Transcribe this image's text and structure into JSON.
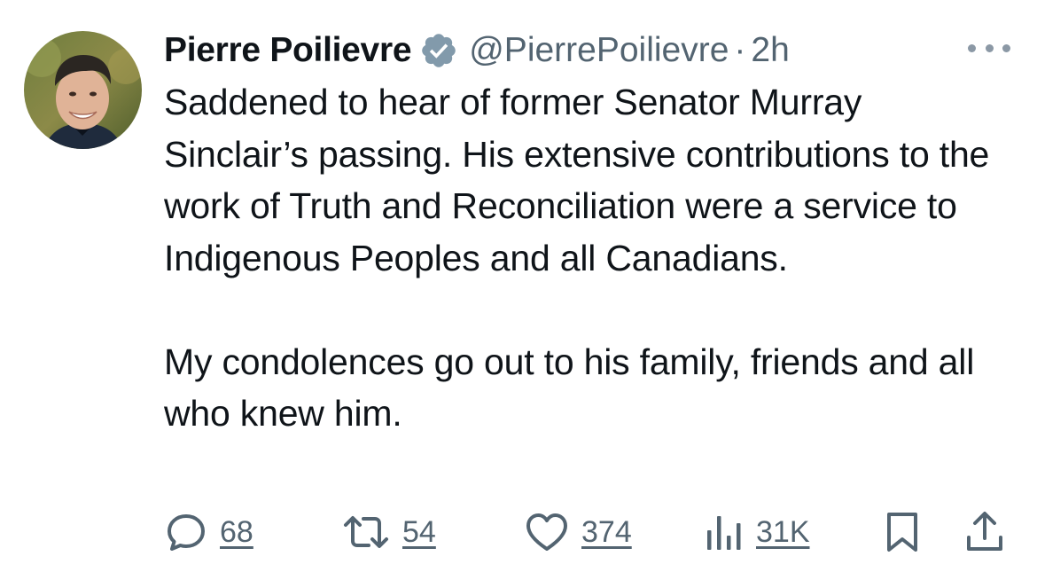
{
  "author": {
    "name": "Pierre Poilievre",
    "handle": "@PierrePoilievre",
    "separator": "·",
    "time": "2h",
    "verified_icon": "verified-badge-icon",
    "verified_color": "#829aab"
  },
  "tweet": {
    "paragraph1": "Saddened to hear of former Senator Murray Sinclair’s passing. His extensive contributions to the work of Truth and Reconciliation were a service to Indigenous Peoples and all Canadians.",
    "paragraph2": "My condolences go out to his family, friends and all who knew him."
  },
  "actions": {
    "replies": "68",
    "reposts": "54",
    "likes": "374",
    "views": "31K",
    "reply_icon": "reply-icon",
    "repost_icon": "repost-icon",
    "like_icon": "heart-icon",
    "views_icon": "bar-chart-icon",
    "bookmark_icon": "bookmark-icon",
    "share_icon": "share-icon"
  },
  "colors": {
    "text_primary": "#0f1419",
    "text_secondary": "#536471",
    "background": "#ffffff"
  }
}
